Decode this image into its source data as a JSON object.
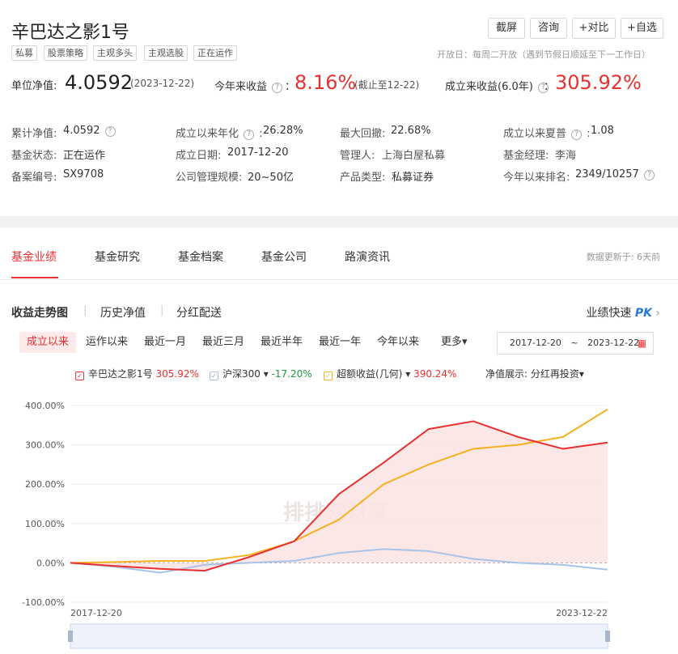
{
  "header": {
    "title": "辛巴达之影1号",
    "tags": [
      "私募",
      "股票策略",
      "主观多头",
      "主观选股",
      "正在运作"
    ],
    "buttons": [
      "截屏",
      "咨询",
      "+对比",
      "+自选"
    ],
    "open_day": "开放日：每周二开放（遇到节假日顺延至下一工作日）"
  },
  "metrics": {
    "nav_label": "单位净值:",
    "nav_value": "4.0592",
    "nav_date": "(2023-12-22)",
    "ytd_label": "今年来收益",
    "ytd_value": "8.16%",
    "ytd_note": "(截止至12-22)",
    "since_label": "成立来收益(6.0年)",
    "since_value": "305.92%",
    "colon": "："
  },
  "info": {
    "rows": [
      [
        "累计净值:",
        "4.0592",
        "成立以来年化",
        "26.28%",
        "最大回撤:",
        "22.68%",
        "成立以来夏普",
        "1.08"
      ],
      [
        "基金状态:",
        "正在运作",
        "成立日期:",
        "2017-12-20",
        "管理人:",
        "上海白屋私募",
        "基金经理:",
        "李海"
      ],
      [
        "备案编号:",
        "SX9708",
        "公司管理规模:",
        "20~50亿",
        "产品类型:",
        "私募证券",
        "今年以来排名:",
        "2349/10257"
      ]
    ]
  },
  "tabs": [
    "基金业绩",
    "基金研究",
    "基金档案",
    "基金公司",
    "路演资讯"
  ],
  "update_text": "数据更新于:  6天前",
  "subtabs": [
    "收益走势图",
    "历史净值",
    "分红配送"
  ],
  "pk_label": "业绩快速",
  "pk_mark": "PK",
  "ranges": [
    "成立以来",
    "运作以来",
    "最近一月",
    "最近三月",
    "最近半年",
    "最近一年",
    "今年以来",
    "更多▾"
  ],
  "date_range": {
    "start": "2017-12-20",
    "tilde": "~",
    "end": "2023-12-22"
  },
  "legend": {
    "fund_name": "辛巴达之影1号",
    "fund_value": "305.92%",
    "index_name": "沪深300",
    "index_value": "-17.20%",
    "excess_name": "超额收益(几何)",
    "excess_value": "390.24%",
    "nav_display_label": "净值展示:",
    "nav_display_value": "分红再投资▾"
  },
  "colors": {
    "fund": "#e93030",
    "index": "#a8c3e8",
    "excess": "#f5b120",
    "accent": "#e93030",
    "link": "#2878d7"
  },
  "watermark": "排排网财富",
  "chart_data": {
    "type": "line",
    "x": [
      "2017-12-20",
      "2018-06",
      "2018-12",
      "2019-06",
      "2019-12",
      "2020-06",
      "2020-12",
      "2021-06",
      "2021-12",
      "2022-06",
      "2022-12",
      "2023-06",
      "2023-12-22"
    ],
    "xticks": [
      "2017-12-20",
      "2023-12-22"
    ],
    "ylim": [
      -100,
      400
    ],
    "yticks": [
      "400.00%",
      "300.00%",
      "200.00%",
      "100.00%",
      "0.00%",
      "-100.00%"
    ],
    "grid": true,
    "series": [
      {
        "name": "辛巴达之影1号",
        "values": [
          0,
          -8,
          -15,
          -20,
          15,
          55,
          175,
          255,
          340,
          360,
          320,
          290,
          305.92
        ]
      },
      {
        "name": "沪深300",
        "values": [
          0,
          -10,
          -25,
          -5,
          0,
          5,
          25,
          35,
          30,
          10,
          0,
          -5,
          -17.2
        ]
      },
      {
        "name": "超额收益(几何)",
        "values": [
          0,
          2,
          5,
          5,
          20,
          55,
          110,
          200,
          250,
          290,
          300,
          320,
          390.24
        ]
      }
    ]
  }
}
